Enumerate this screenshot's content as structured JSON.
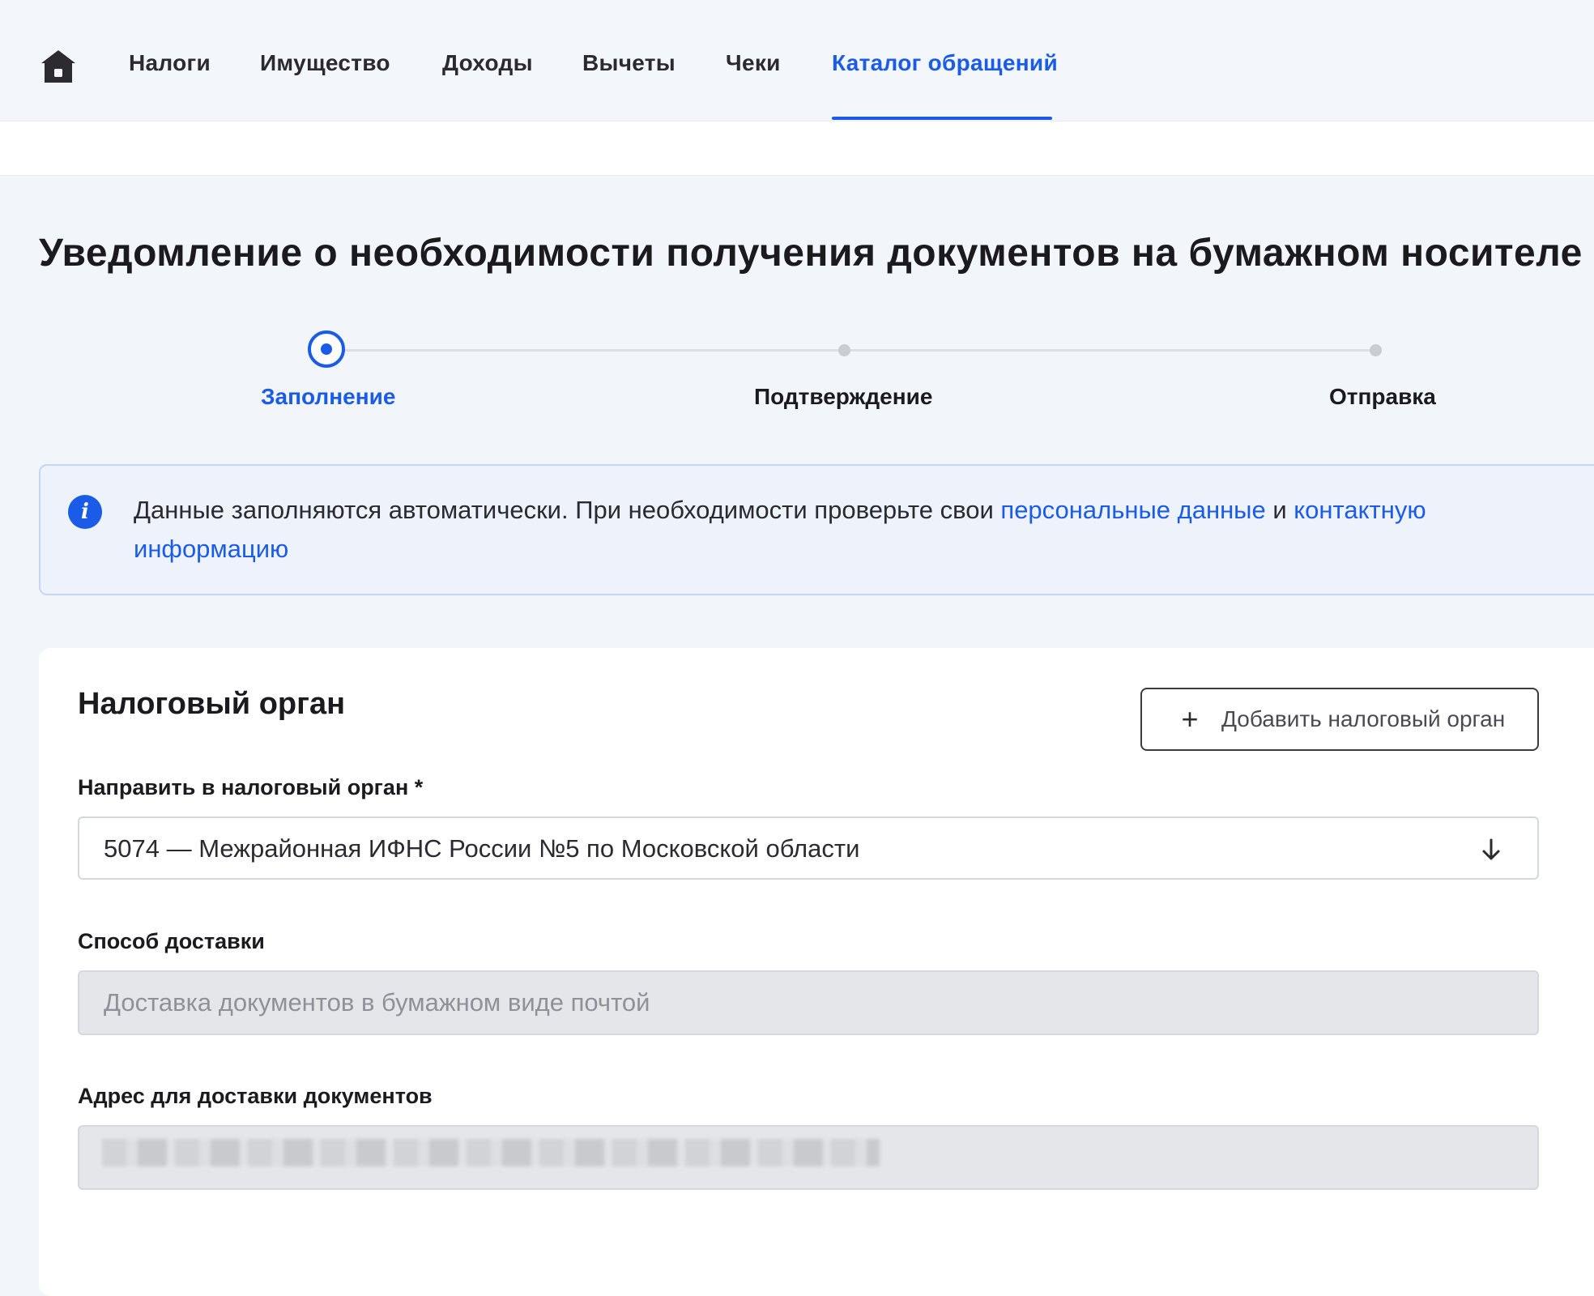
{
  "nav": {
    "items": [
      "Налоги",
      "Имущество",
      "Доходы",
      "Вычеты",
      "Чеки",
      "Каталог обращений"
    ],
    "active": "Каталог обращений"
  },
  "page": {
    "title": "Уведомление о необходимости получения документов на бумажном носителе"
  },
  "stepper": {
    "steps": [
      "Заполнение",
      "Подтверждение",
      "Отправка"
    ],
    "current": 0
  },
  "info": {
    "text_before": "Данные заполняются автоматически. При необходимости проверьте свои ",
    "link1": "персональные данные",
    "text_between": " и ",
    "link2": "контактную информацию"
  },
  "form": {
    "section_title": "Налоговый орган",
    "add_button": "Добавить налоговый орган",
    "tax_office_label": "Направить в налоговый орган *",
    "tax_office_value": "5074 — Межрайонная ИФНС России №5 по Московской области",
    "delivery_label": "Способ доставки",
    "delivery_value": "Доставка документов в бумажном виде почтой",
    "address_label": "Адрес для доставки документов",
    "address_value": ""
  },
  "colors": {
    "accent": "#1a5ce8",
    "background": "#f2f6fb",
    "disabled_field": "#e4e6ea"
  },
  "icons": [
    "home-icon",
    "info-icon",
    "plus-icon",
    "arrow-down-icon"
  ]
}
